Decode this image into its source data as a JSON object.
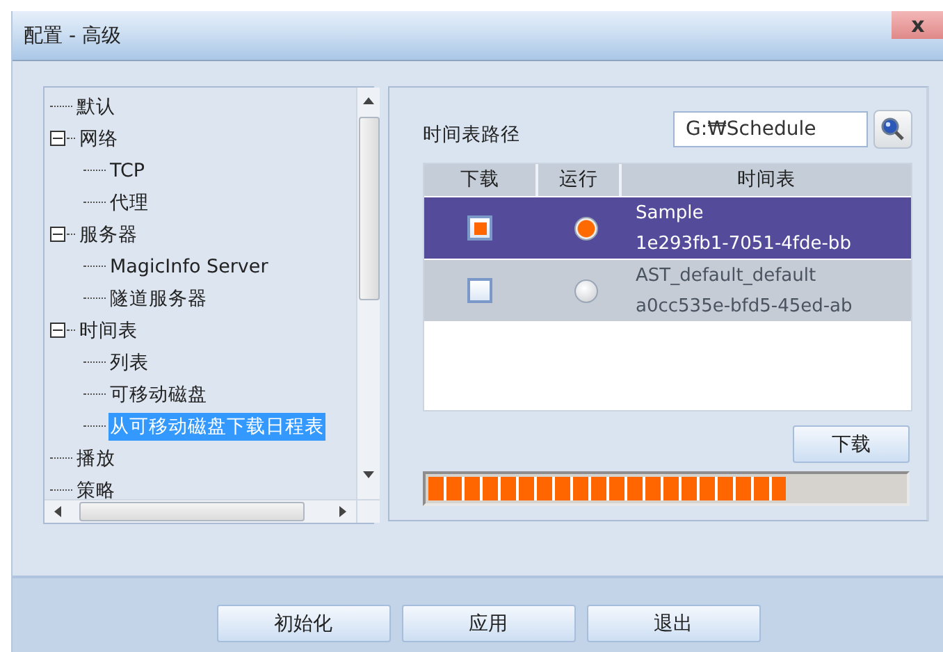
{
  "window": {
    "title": "配置 - 高级",
    "close": "x"
  },
  "tree": [
    {
      "label": "默认",
      "selected": false
    },
    {
      "label": "网络",
      "selected": false,
      "expanded": true,
      "children": [
        {
          "label": "TCP",
          "selected": false
        },
        {
          "label": "代理",
          "selected": false
        }
      ]
    },
    {
      "label": "服务器",
      "selected": false,
      "expanded": true,
      "children": [
        {
          "label": "MagicInfo Server",
          "selected": false
        },
        {
          "label": "隧道服务器",
          "selected": false
        }
      ]
    },
    {
      "label": "时间表",
      "selected": false,
      "expanded": true,
      "children": [
        {
          "label": "列表",
          "selected": false
        },
        {
          "label": "可移动磁盘",
          "selected": false
        },
        {
          "label": "从可移动磁盘下载日程表",
          "selected": true
        }
      ]
    },
    {
      "label": "播放",
      "selected": false
    },
    {
      "label": "策略",
      "selected": false
    }
  ],
  "schedule_path": {
    "label": "时间表路径",
    "value": "G:₩Schedule"
  },
  "table": {
    "columns": [
      "下载",
      "运行",
      "时间表"
    ],
    "rows": [
      {
        "download": true,
        "run": true,
        "selected": true,
        "name": "Sample",
        "id": "1e293fb1-7051-4fde-bb"
      },
      {
        "download": false,
        "run": false,
        "selected": false,
        "name": "AST_default_default",
        "id": "a0cc535e-bfd5-45ed-ab"
      }
    ]
  },
  "download_button": "下载",
  "progress": {
    "level": 0.75
  },
  "buttons": [
    "初始化",
    "应用",
    "退出"
  ]
}
